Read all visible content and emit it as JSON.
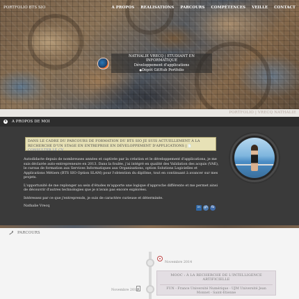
{
  "nav": {
    "brand": "PORTFOLIO BTS SIO",
    "items": [
      "A PROPOS",
      "REALISATIONS",
      "PARCOURS",
      "COMPÉTENCES",
      "VEILLE",
      "CONTACT"
    ]
  },
  "hero": {
    "line1": "NATHALIE VRECQ | ETUDIANT EN INFORMATIQUE",
    "line2": "Développement d'applications",
    "line3": "Dépôt GitHub Portfolio"
  },
  "strip": {
    "text": "PORTFOLIO | VRECQ NATHALIE"
  },
  "about": {
    "heading": "A PROPOS DE MOI",
    "callout_text": "DANS LE CADRE DU PARCOURS DE FORMATION DU BTS SIO JE SUIS ACTUELLEMENT À LA RECHERCHE D'UN STAGE EN ENTREPRISE EN DÉVELOPPEMENT D'APPLICATIONS |",
    "callout_link": "CONSULTER LE CV",
    "paragraphs": [
      "Autodidacte depuis de nombreuses années et captivée par la création et le développement d'applications, je me suis déclarée auto-entrepreneure en 2013. Dans la foulée, j'ai intégré en qualité des Validation des acquis (VAE), le cursus de formation aux Services Informatiques aux Organisations, option Solutions Logicielles et Applications Métiers (BTS SIO Option SLAM) pour l'obtention du diplôme, tout en continuant à avancer sur mes projets.",
      "L'opportunité de me replonger au sein d'études m'apporte une logique d'approche différente et me permet ainsi de découvrir d'autres technologies que je n'avais pas encore explorées.",
      "Intéressez par ce que j'entreprends, je suis de caractère curieuse et déterminée.",
      "Nathalie Vrecq"
    ],
    "socials": [
      "in",
      "gh",
      "fb"
    ]
  },
  "parcours": {
    "heading": "PARCOURS",
    "entries": [
      {
        "date": "Novembre 2014",
        "title": "MOOC : À LA RECHERCHE DE L'INTELLIGENCE ARTIFICIELLE",
        "body": "FUN - France Université Numérique - UJM Université Jean Monnet - Saint-Etienne"
      },
      {
        "date": "Novembre 2014"
      }
    ]
  }
}
